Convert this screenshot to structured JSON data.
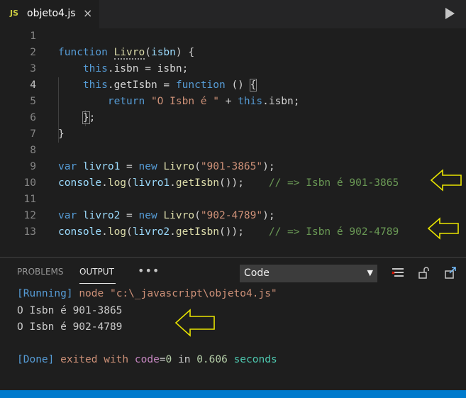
{
  "tab": {
    "lang_badge": "JS",
    "filename": "objeto4.js",
    "close": "×"
  },
  "editor": {
    "lines": [
      {
        "n": "1"
      },
      {
        "n": "2",
        "t": [
          [
            "kw",
            "function "
          ],
          [
            "fn",
            "Livro"
          ],
          [
            "",
            "("
          ],
          [
            "pm",
            "isbn"
          ],
          [
            "",
            ") {"
          ]
        ]
      },
      {
        "n": "3",
        "t": [
          [
            "",
            "    "
          ],
          [
            "kw",
            "this"
          ],
          [
            "",
            ".isbn = isbn;"
          ]
        ]
      },
      {
        "n": "4",
        "t": [
          [
            "",
            "    "
          ],
          [
            "kw",
            "this"
          ],
          [
            "",
            ".getIsbn = "
          ],
          [
            "kw",
            "function"
          ],
          [
            "",
            " () "
          ],
          [
            "box",
            "{"
          ]
        ]
      },
      {
        "n": "5",
        "t": [
          [
            "",
            "        "
          ],
          [
            "kw",
            "return "
          ],
          [
            "st",
            "\"O Isbn é \""
          ],
          [
            "",
            " + "
          ],
          [
            "kw",
            "this"
          ],
          [
            "",
            ".isbn;"
          ]
        ]
      },
      {
        "n": "6",
        "t": [
          [
            "",
            "    "
          ],
          [
            "box",
            "}"
          ],
          [
            "",
            ";"
          ]
        ]
      },
      {
        "n": "7",
        "t": [
          [
            "",
            "}"
          ]
        ]
      },
      {
        "n": "8"
      },
      {
        "n": "9",
        "t": [
          [
            "kw",
            "var "
          ],
          [
            "pm",
            "livro1"
          ],
          [
            "",
            " = "
          ],
          [
            "kw",
            "new "
          ],
          [
            "fn",
            "Livro"
          ],
          [
            "",
            "("
          ],
          [
            "st",
            "\"901-3865\""
          ],
          [
            "",
            ");"
          ]
        ]
      },
      {
        "n": "10",
        "t": [
          [
            "pm",
            "console"
          ],
          [
            "",
            "."
          ],
          [
            "fn",
            "log"
          ],
          [
            "",
            "("
          ],
          [
            "pm",
            "livro1"
          ],
          [
            "",
            "."
          ],
          [
            "fn",
            "getIsbn"
          ],
          [
            "",
            "());    "
          ],
          [
            "cm",
            "// => Isbn é 901-3865"
          ]
        ]
      },
      {
        "n": "11"
      },
      {
        "n": "12",
        "t": [
          [
            "kw",
            "var "
          ],
          [
            "pm",
            "livro2"
          ],
          [
            "",
            " = "
          ],
          [
            "kw",
            "new "
          ],
          [
            "fn",
            "Livro"
          ],
          [
            "",
            "("
          ],
          [
            "st",
            "\"902-4789\""
          ],
          [
            "",
            ");"
          ]
        ]
      },
      {
        "n": "13",
        "t": [
          [
            "pm",
            "console"
          ],
          [
            "",
            "."
          ],
          [
            "fn",
            "log"
          ],
          [
            "",
            "("
          ],
          [
            "pm",
            "livro2"
          ],
          [
            "",
            "."
          ],
          [
            "fn",
            "getIsbn"
          ],
          [
            "",
            "());    "
          ],
          [
            "cm",
            "// => Isbn é 902-4789"
          ]
        ]
      }
    ],
    "active_line": "4"
  },
  "panel": {
    "tabs": {
      "problems": "PROBLEMS",
      "output": "OUTPUT",
      "more": "•••"
    },
    "channel": "Code",
    "output": {
      "l1": [
        [
          "o-blue",
          "[Running] "
        ],
        [
          "o-orange",
          "node \"c:\\_javascript\\objeto4.js\""
        ]
      ],
      "l2": "O Isbn é 901-3865",
      "l3": "O Isbn é 902-4789",
      "l5": [
        [
          "o-blue",
          "[Done] "
        ],
        [
          "o-orange",
          "exited with "
        ],
        [
          "o-purple",
          "code"
        ],
        [
          "",
          "="
        ],
        [
          "o-green",
          "0"
        ],
        [
          "",
          " in "
        ],
        [
          "o-green",
          "0.606"
        ],
        [
          "o-teal",
          " seconds"
        ]
      ]
    }
  },
  "colors": {
    "accent": "#007acc",
    "arrow": "#e8e400"
  }
}
